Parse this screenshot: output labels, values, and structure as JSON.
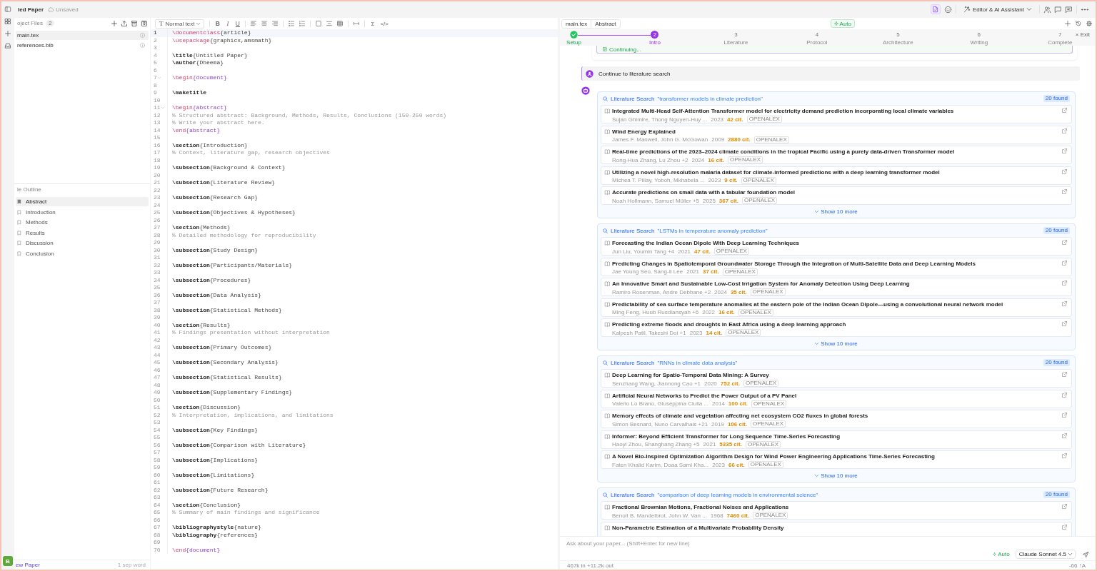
{
  "topbar": {
    "title": "led Paper",
    "save_status": "Unsaved",
    "view_menu": "Editor & AI Assistant"
  },
  "rail": {
    "avatar": "B"
  },
  "files": {
    "heading": "oject Files",
    "count": "2",
    "items": [
      {
        "name": "main.tex",
        "selected": true
      },
      {
        "name": "references.bib",
        "selected": false
      }
    ]
  },
  "outline": {
    "heading": "le Outline",
    "items": [
      {
        "label": "Abstract",
        "selected": true
      },
      {
        "label": "Introduction",
        "selected": false
      },
      {
        "label": "Methods",
        "selected": false
      },
      {
        "label": "Results",
        "selected": false
      },
      {
        "label": "Discussion",
        "selected": false
      },
      {
        "label": "Conclusion",
        "selected": false
      }
    ]
  },
  "left_footer": {
    "link": "ew Paper",
    "note": "1 sep word"
  },
  "editor": {
    "style_select": {
      "glyph": "T",
      "value": "Normal text"
    },
    "format_buttons": [
      "B",
      "I",
      "U"
    ],
    "insert_buttons": [
      "Σ",
      "</>"
    ],
    "lines": [
      {
        "number": "1",
        "fold": false,
        "current": true,
        "tokens": [
          {
            "kind": "command",
            "text": "\\documentclass"
          },
          {
            "kind": "argument",
            "text": "{article}"
          }
        ]
      },
      {
        "number": "2",
        "fold": false,
        "current": false,
        "tokens": [
          {
            "kind": "command",
            "text": "\\usepackage"
          },
          {
            "kind": "argument",
            "text": "{graphicx,amsmath}"
          }
        ]
      },
      {
        "number": "3",
        "fold": false,
        "current": false
      },
      {
        "number": "4",
        "fold": false,
        "current": false,
        "tokens": [
          {
            "kind": "keyword",
            "text": "\\title"
          },
          {
            "kind": "argument",
            "text": "{Untitled Paper}"
          }
        ]
      },
      {
        "number": "5",
        "fold": false,
        "current": false,
        "tokens": [
          {
            "kind": "keyword",
            "text": "\\author"
          },
          {
            "kind": "argument",
            "text": "{Dheema}"
          }
        ]
      },
      {
        "number": "6",
        "fold": false,
        "current": false
      },
      {
        "number": "7",
        "fold": true,
        "current": false,
        "tokens": [
          {
            "kind": "command",
            "text": "\\begin"
          },
          {
            "kind": "environment",
            "text": "{document}"
          }
        ]
      },
      {
        "number": "8",
        "fold": false,
        "current": false
      },
      {
        "number": "9",
        "fold": false,
        "current": false,
        "tokens": [
          {
            "kind": "keyword",
            "text": "\\maketitle"
          }
        ]
      },
      {
        "number": "10",
        "fold": false,
        "current": false
      },
      {
        "number": "11",
        "fold": true,
        "current": false,
        "tokens": [
          {
            "kind": "command",
            "text": "\\begin"
          },
          {
            "kind": "environment",
            "text": "{abstract}"
          }
        ]
      },
      {
        "number": "12",
        "fold": false,
        "current": false,
        "tokens": [
          {
            "kind": "comment",
            "text": "% Structured abstract: Background, Methods, Results, Conclusions (150-250 words)"
          }
        ]
      },
      {
        "number": "13",
        "fold": false,
        "current": false,
        "tokens": [
          {
            "kind": "comment",
            "text": "% Write your abstract here."
          }
        ]
      },
      {
        "number": "14",
        "fold": false,
        "current": false,
        "tokens": [
          {
            "kind": "command",
            "text": "\\end"
          },
          {
            "kind": "environment",
            "text": "{abstract}"
          }
        ]
      },
      {
        "number": "15",
        "fold": false,
        "current": false
      },
      {
        "number": "16",
        "fold": false,
        "current": false,
        "tokens": [
          {
            "kind": "keyword",
            "text": "\\section"
          },
          {
            "kind": "argument",
            "text": "{Introduction}"
          }
        ]
      },
      {
        "number": "17",
        "fold": false,
        "current": false,
        "tokens": [
          {
            "kind": "comment",
            "text": "% Context, literature gap, research objectives"
          }
        ]
      },
      {
        "number": "18",
        "fold": false,
        "current": false
      },
      {
        "number": "19",
        "fold": false,
        "current": false,
        "tokens": [
          {
            "kind": "keyword",
            "text": "\\subsection"
          },
          {
            "kind": "argument",
            "text": "{Background & Context}"
          }
        ]
      },
      {
        "number": "20",
        "fold": false,
        "current": false
      },
      {
        "number": "21",
        "fold": false,
        "current": false,
        "tokens": [
          {
            "kind": "keyword",
            "text": "\\subsection"
          },
          {
            "kind": "argument",
            "text": "{Literature Review}"
          }
        ]
      },
      {
        "number": "22",
        "fold": false,
        "current": false
      },
      {
        "number": "23",
        "fold": false,
        "current": false,
        "tokens": [
          {
            "kind": "keyword",
            "text": "\\subsection"
          },
          {
            "kind": "argument",
            "text": "{Research Gap}"
          }
        ]
      },
      {
        "number": "24",
        "fold": false,
        "current": false
      },
      {
        "number": "25",
        "fold": false,
        "current": false,
        "tokens": [
          {
            "kind": "keyword",
            "text": "\\subsection"
          },
          {
            "kind": "argument",
            "text": "{Objectives & Hypotheses}"
          }
        ]
      },
      {
        "number": "26",
        "fold": false,
        "current": false
      },
      {
        "number": "27",
        "fold": false,
        "current": false,
        "tokens": [
          {
            "kind": "keyword",
            "text": "\\section"
          },
          {
            "kind": "argument",
            "text": "{Methods}"
          }
        ]
      },
      {
        "number": "28",
        "fold": false,
        "current": false,
        "tokens": [
          {
            "kind": "comment",
            "text": "% Detailed methodology for reproducibility"
          }
        ]
      },
      {
        "number": "29",
        "fold": false,
        "current": false
      },
      {
        "number": "30",
        "fold": false,
        "current": false,
        "tokens": [
          {
            "kind": "keyword",
            "text": "\\subsection"
          },
          {
            "kind": "argument",
            "text": "{Study Design}"
          }
        ]
      },
      {
        "number": "31",
        "fold": false,
        "current": false
      },
      {
        "number": "32",
        "fold": false,
        "current": false,
        "tokens": [
          {
            "kind": "keyword",
            "text": "\\subsection"
          },
          {
            "kind": "argument",
            "text": "{Participants/Materials}"
          }
        ]
      },
      {
        "number": "33",
        "fold": false,
        "current": false
      },
      {
        "number": "34",
        "fold": false,
        "current": false,
        "tokens": [
          {
            "kind": "keyword",
            "text": "\\subsection"
          },
          {
            "kind": "argument",
            "text": "{Procedures}"
          }
        ]
      },
      {
        "number": "35",
        "fold": false,
        "current": false
      },
      {
        "number": "36",
        "fold": false,
        "current": false,
        "tokens": [
          {
            "kind": "keyword",
            "text": "\\subsection"
          },
          {
            "kind": "argument",
            "text": "{Data Analysis}"
          }
        ]
      },
      {
        "number": "37",
        "fold": false,
        "current": false
      },
      {
        "number": "38",
        "fold": false,
        "current": false,
        "tokens": [
          {
            "kind": "keyword",
            "text": "\\subsection"
          },
          {
            "kind": "argument",
            "text": "{Statistical Methods}"
          }
        ]
      },
      {
        "number": "39",
        "fold": false,
        "current": false
      },
      {
        "number": "40",
        "fold": false,
        "current": false,
        "tokens": [
          {
            "kind": "keyword",
            "text": "\\section"
          },
          {
            "kind": "argument",
            "text": "{Results}"
          }
        ]
      },
      {
        "number": "41",
        "fold": false,
        "current": false,
        "tokens": [
          {
            "kind": "comment",
            "text": "% Findings presentation without interpretation"
          }
        ]
      },
      {
        "number": "42",
        "fold": false,
        "current": false
      },
      {
        "number": "43",
        "fold": false,
        "current": false,
        "tokens": [
          {
            "kind": "keyword",
            "text": "\\subsection"
          },
          {
            "kind": "argument",
            "text": "{Primary Outcomes}"
          }
        ]
      },
      {
        "number": "44",
        "fold": false,
        "current": false
      },
      {
        "number": "45",
        "fold": false,
        "current": false,
        "tokens": [
          {
            "kind": "keyword",
            "text": "\\subsection"
          },
          {
            "kind": "argument",
            "text": "{Secondary Analysis}"
          }
        ]
      },
      {
        "number": "46",
        "fold": false,
        "current": false
      },
      {
        "number": "47",
        "fold": false,
        "current": false,
        "tokens": [
          {
            "kind": "keyword",
            "text": "\\subsection"
          },
          {
            "kind": "argument",
            "text": "{Statistical Results}"
          }
        ]
      },
      {
        "number": "48",
        "fold": false,
        "current": false
      },
      {
        "number": "49",
        "fold": false,
        "current": false,
        "tokens": [
          {
            "kind": "keyword",
            "text": "\\subsection"
          },
          {
            "kind": "argument",
            "text": "{Supplementary Findings}"
          }
        ]
      },
      {
        "number": "50",
        "fold": false,
        "current": false
      },
      {
        "number": "51",
        "fold": false,
        "current": false,
        "tokens": [
          {
            "kind": "keyword",
            "text": "\\section"
          },
          {
            "kind": "argument",
            "text": "{Discussion}"
          }
        ]
      },
      {
        "number": "52",
        "fold": false,
        "current": false,
        "tokens": [
          {
            "kind": "comment",
            "text": "% Interpretation, implications, and limitations"
          }
        ]
      },
      {
        "number": "53",
        "fold": false,
        "current": false
      },
      {
        "number": "54",
        "fold": false,
        "current": false,
        "tokens": [
          {
            "kind": "keyword",
            "text": "\\subsection"
          },
          {
            "kind": "argument",
            "text": "{Key Findings}"
          }
        ]
      },
      {
        "number": "55",
        "fold": false,
        "current": false
      },
      {
        "number": "56",
        "fold": false,
        "current": false,
        "tokens": [
          {
            "kind": "keyword",
            "text": "\\subsection"
          },
          {
            "kind": "argument",
            "text": "{Comparison with Literature}"
          }
        ]
      },
      {
        "number": "57",
        "fold": false,
        "current": false
      },
      {
        "number": "58",
        "fold": false,
        "current": false,
        "tokens": [
          {
            "kind": "keyword",
            "text": "\\subsection"
          },
          {
            "kind": "argument",
            "text": "{Implications}"
          }
        ]
      },
      {
        "number": "59",
        "fold": false,
        "current": false
      },
      {
        "number": "60",
        "fold": false,
        "current": false,
        "tokens": [
          {
            "kind": "keyword",
            "text": "\\subsection"
          },
          {
            "kind": "argument",
            "text": "{Limitations}"
          }
        ]
      },
      {
        "number": "61",
        "fold": false,
        "current": false
      },
      {
        "number": "62",
        "fold": false,
        "current": false,
        "tokens": [
          {
            "kind": "keyword",
            "text": "\\subsection"
          },
          {
            "kind": "argument",
            "text": "{Future Research}"
          }
        ]
      },
      {
        "number": "63",
        "fold": false,
        "current": false
      },
      {
        "number": "64",
        "fold": false,
        "current": false,
        "tokens": [
          {
            "kind": "keyword",
            "text": "\\section"
          },
          {
            "kind": "argument",
            "text": "{Conclusion}"
          }
        ]
      },
      {
        "number": "65",
        "fold": false,
        "current": false,
        "tokens": [
          {
            "kind": "comment",
            "text": "% Summary of main findings and significance"
          }
        ]
      },
      {
        "number": "66",
        "fold": false,
        "current": false
      },
      {
        "number": "67",
        "fold": false,
        "current": false,
        "tokens": [
          {
            "kind": "keyword",
            "text": "\\bibliographystyle"
          },
          {
            "kind": "argument",
            "text": "{nature}"
          }
        ]
      },
      {
        "number": "68",
        "fold": false,
        "current": false,
        "tokens": [
          {
            "kind": "keyword",
            "text": "\\bibliography"
          },
          {
            "kind": "argument",
            "text": "{references}"
          }
        ]
      },
      {
        "number": "69",
        "fold": false,
        "current": false
      },
      {
        "number": "70",
        "fold": false,
        "current": false,
        "tokens": [
          {
            "kind": "command",
            "text": "\\end"
          },
          {
            "kind": "environment",
            "text": "{document}"
          }
        ]
      }
    ]
  },
  "assistant": {
    "context": [
      "main.tex",
      "Abstract"
    ],
    "mode": "Auto",
    "exit": "× Exit",
    "steps": [
      {
        "label": "Setup",
        "done": true,
        "current": false
      },
      {
        "number": "2",
        "label": "Intro",
        "done": false,
        "current": true
      },
      {
        "number": "3",
        "label": "Literature",
        "done": false,
        "current": false
      },
      {
        "number": "4",
        "label": "Protocol",
        "done": false,
        "current": false
      },
      {
        "number": "5",
        "label": "Architecture",
        "done": false,
        "current": false
      },
      {
        "number": "6",
        "label": "Writing",
        "done": false,
        "current": false
      },
      {
        "number": "7",
        "label": "Complete",
        "done": false,
        "current": false
      }
    ],
    "previous_status": "Continuing...",
    "user_message": "Continue to literature search",
    "searches": [
      {
        "title": "Literature Search",
        "query": "\"transformer models in climate prediction\"",
        "found": "20 found",
        "more": "Show 10 more",
        "results": [
          {
            "title": "Integrated Multi-Head Self-Attention Transformer model for electricity demand prediction incorporating local climate variables",
            "authors": "Sujan Ghimire, Thong Nguyen-Huy ...",
            "year": "2023",
            "citations": "42 cit.",
            "source": "OPENALEX"
          },
          {
            "title": "Wind Energy Explained",
            "authors": "James F. Manwell, John G. McGowan",
            "year": "2009",
            "citations": "2880 cit.",
            "source": "OPENALEX"
          },
          {
            "title": "Real-time predictions of the 2023–2024 climate conditions in the tropical Pacific using a purely data-driven Transformer model",
            "authors": "Rong-Hua Zhang, Lu Zhou +2",
            "year": "2024",
            "citations": "16 cit.",
            "source": "OPENALEX"
          },
          {
            "title": "Utilizing a novel high-resolution malaria dataset for climate-informed predictions with a deep learning transformer model",
            "authors": "Michea T. Pillay, Yoboh, Mkhabela ...",
            "year": "2023",
            "citations": "9 cit.",
            "source": "OPENALEX"
          },
          {
            "title": "Accurate predictions on small data with a tabular foundation model",
            "authors": "Noah Hollmann, Samuel Müller +5",
            "year": "2025",
            "citations": "367 cit.",
            "source": "OPENALEX"
          }
        ]
      },
      {
        "title": "Literature Search",
        "query": "\"LSTMs in temperature anomaly prediction\"",
        "found": "20 found",
        "more": "Show 10 more",
        "results": [
          {
            "title": "Forecasting the Indian Ocean Dipole With Deep Learning Techniques",
            "authors": "Jun Liu, Youmin Tang +4",
            "year": "2021",
            "citations": "47 cit.",
            "source": "OPENALEX"
          },
          {
            "title": "Predicting Changes in Spatiotemporal Groundwater Storage Through the Integration of Multi-Satellite Data and Deep Learning Models",
            "authors": "Jae Young Seo, Sang-Il Lee",
            "year": "2021",
            "citations": "37 cit.",
            "source": "OPENALEX"
          },
          {
            "title": "An Innovative Smart and Sustainable Low-Cost Irrigation System for Anomaly Detection Using Deep Learning",
            "authors": "Ramiro Rosenman, Andre Debbane +2",
            "year": "2024",
            "citations": "35 cit.",
            "source": "OPENALEX"
          },
          {
            "title": "Predictability of sea surface temperature anomalies at the eastern pole of the Indian Ocean Dipole—using a convolutional neural network model",
            "authors": "Ming Feng, Huub Rusdiansyah +6",
            "year": "2022",
            "citations": "16 cit.",
            "source": "OPENALEX"
          },
          {
            "title": "Predicting extreme floods and droughts in East Africa using a deep learning approach",
            "authors": "Kalpesh Patil, Takeshi Doi +1",
            "year": "2023",
            "citations": "14 cit.",
            "source": "OPENALEX"
          }
        ]
      },
      {
        "title": "Literature Search",
        "query": "\"RNNs in climate data analysis\"",
        "found": "20 found",
        "more": "Show 10 more",
        "results": [
          {
            "title": "Deep Learning for Spatio-Temporal Data Mining: A Survey",
            "authors": "Senzhang Wang, Jiannong Cao +1",
            "year": "2020",
            "citations": "752 cit.",
            "source": "OPENALEX"
          },
          {
            "title": "Artificial Neural Networks to Predict the Power Output of a PV Panel",
            "authors": "Valerio Lo Brano, Giuseppina Ciulla ...",
            "year": "2014",
            "citations": "100 cit.",
            "source": "OPENALEX"
          },
          {
            "title": "Memory effects of climate and vegetation affecting net ecosystem CO2 fluxes in global forests",
            "authors": "Simon Besnard, Nuno Carvalhais +21",
            "year": "2019",
            "citations": "106 cit.",
            "source": "OPENALEX"
          },
          {
            "title": "Informer: Beyond Efficient Transformer for Long Sequence Time-Series Forecasting",
            "authors": "Haoyi Zhou, Shanghang Zhang +5",
            "year": "2021",
            "citations": "5335 cit.",
            "source": "OPENALEX"
          },
          {
            "title": "A Novel Bio-Inspired Optimization Algorithm Design for Wind Power Engineering Applications Time-Series Forecasting",
            "authors": "Faten Khalid Karim, Doaa Sami Kha...",
            "year": "2023",
            "citations": "66 cit.",
            "source": "OPENALEX"
          }
        ]
      },
      {
        "title": "Literature Search",
        "query": "\"comparison of deep learning models in environmental science\"",
        "found": "20 found",
        "results": [
          {
            "title": "Fractional Brownian Motions, Fractional Noises and Applications",
            "authors": "Benoit B. Mandelbrot, John W. Van ...",
            "year": "1968",
            "citations": "7460 cit.",
            "source": "OPENALEX"
          },
          {
            "title": "Non-Parametric Estimation of a Multivariate Probability Density"
          }
        ]
      }
    ],
    "input": {
      "placeholder": "Ask about your paper... (Shift+Enter for new line)",
      "mode": "Auto",
      "model": "Claude Sonnet 4.5"
    },
    "usage": "467k in +11.2k out",
    "usage_right": "-66 ↑A"
  }
}
